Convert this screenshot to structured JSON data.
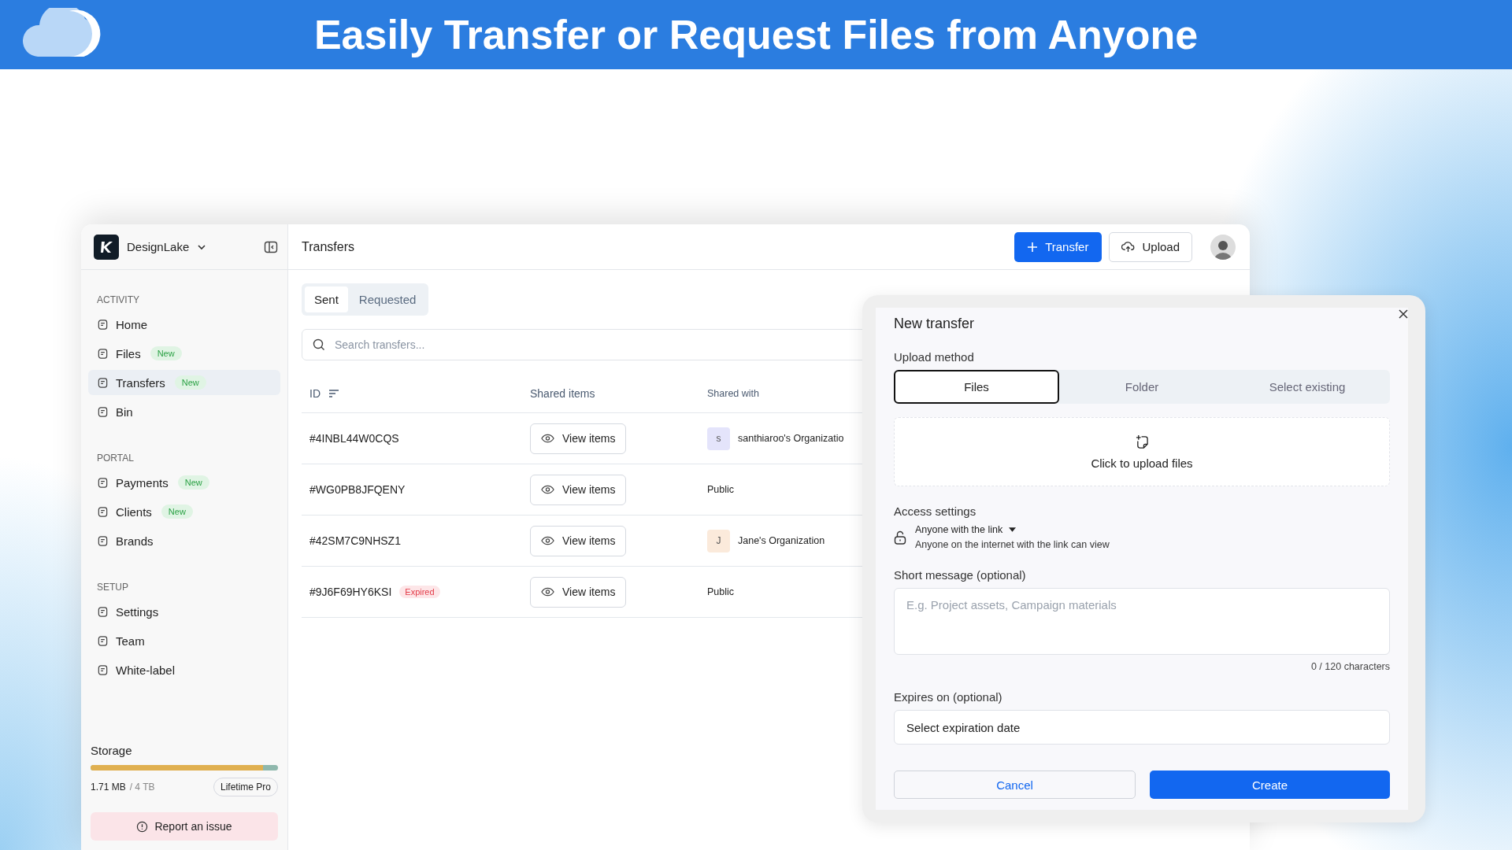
{
  "banner": {
    "title": "Easily Transfer or Request Files from Anyone"
  },
  "sidebar": {
    "workspace": {
      "name": "DesignLake"
    },
    "sections": [
      {
        "heading": "ACTIVITY",
        "items": [
          {
            "label": "Home",
            "selected": false
          },
          {
            "label": "Files",
            "badge": "New",
            "selected": false
          },
          {
            "label": "Transfers",
            "badge": "New",
            "selected": true
          },
          {
            "label": "Bin",
            "selected": false
          }
        ]
      },
      {
        "heading": "PORTAL",
        "items": [
          {
            "label": "Payments",
            "badge": "New",
            "selected": false
          },
          {
            "label": "Clients",
            "badge": "New",
            "selected": false
          },
          {
            "label": "Brands",
            "selected": false
          }
        ]
      },
      {
        "heading": "SETUP",
        "items": [
          {
            "label": "Settings",
            "selected": false
          },
          {
            "label": "Team",
            "selected": false
          },
          {
            "label": "White-label",
            "selected": false
          }
        ]
      }
    ],
    "storage": {
      "label": "Storage",
      "level": 0.92,
      "used": "1.71 MB",
      "total": "/ 4 TB",
      "plan": "Lifetime Pro"
    },
    "report_button": "Report an issue"
  },
  "topbar": {
    "title": "Transfers",
    "transfer_button": "Transfer",
    "upload_button": "Upload"
  },
  "tabs": [
    {
      "label": "Sent",
      "selected": true
    },
    {
      "label": "Requested",
      "selected": false
    }
  ],
  "search": {
    "placeholder": "Search transfers..."
  },
  "table": {
    "columns": [
      {
        "label": "ID"
      },
      {
        "label": "Shared items"
      },
      {
        "label": "Shared with"
      }
    ],
    "rows": [
      {
        "id": "#4INBL44W0CQS",
        "shared_items": "View items",
        "shared_with": {
          "avatar": "s",
          "color": "#e4e4fb",
          "name": "santhiaroo's Organizatio"
        }
      },
      {
        "id": "#WG0PB8JFQENY",
        "shared_items": "View items",
        "shared_with": {
          "name": "Public"
        }
      },
      {
        "id": "#42SM7C9NHSZ1",
        "shared_items": "View items",
        "shared_with": {
          "avatar": "J",
          "color": "#fbeadb",
          "name": "Jane's Organization"
        }
      },
      {
        "id": "#9J6F69HY6KSI",
        "badge": "Expired",
        "shared_items": "View items",
        "shared_with": {
          "name": "Public"
        }
      }
    ]
  },
  "dialog": {
    "title": "New transfer",
    "upload_method": {
      "label": "Upload method",
      "options": [
        {
          "label": "Files",
          "selected": true
        },
        {
          "label": "Folder",
          "selected": false
        },
        {
          "label": "Select existing",
          "selected": false
        }
      ]
    },
    "dropzone": {
      "text": "Click to upload files"
    },
    "access": {
      "label": "Access settings",
      "mode": "Anyone with the link",
      "description": "Anyone on the internet with the link can view"
    },
    "message": {
      "label": "Short message (optional)",
      "placeholder": "E.g. Project assets, Campaign materials",
      "counter": "0 / 120 characters"
    },
    "expires": {
      "label": "Expires on (optional)",
      "value": "Select expiration date"
    },
    "buttons": {
      "cancel": "Cancel",
      "create": "Create"
    }
  }
}
